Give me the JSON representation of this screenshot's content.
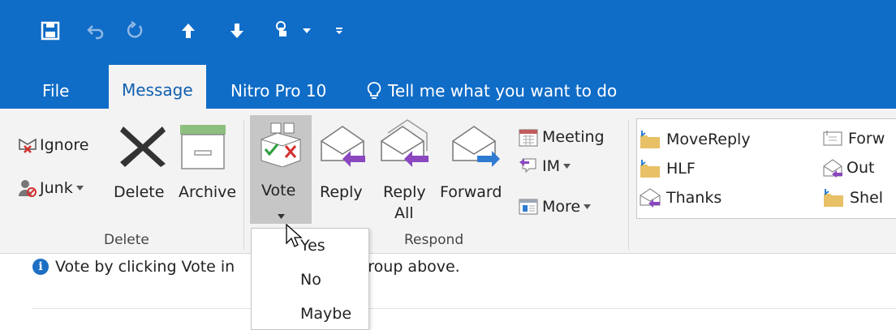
{
  "qat": {
    "icons": [
      "save-icon",
      "undo-icon",
      "redo-icon",
      "up-arrow-icon",
      "down-arrow-icon",
      "touch-mode-icon",
      "dropdown-icon",
      "customize-icon"
    ]
  },
  "tabs": [
    {
      "label": "File"
    },
    {
      "label": "Message"
    },
    {
      "label": "Nitro Pro 10"
    },
    {
      "label": "Tell me what you want to do"
    }
  ],
  "ribbon": {
    "delete_group": {
      "label": "Delete",
      "ignore": "Ignore",
      "junk": "Junk",
      "delete": "Delete",
      "archive": "Archive"
    },
    "respond_group": {
      "label": "Respond",
      "vote": "Vote",
      "reply": "Reply",
      "reply_all_line1": "Reply",
      "reply_all_line2": "All",
      "forward": "Forward",
      "meeting": "Meeting",
      "im": "IM",
      "more": "More"
    },
    "quick_steps": {
      "col1": [
        "MoveReply",
        "HLF",
        "Thanks"
      ],
      "col2": [
        "Forw",
        "Out",
        "Shel"
      ]
    }
  },
  "info_bar": {
    "text_before": "Vote by clicking Vote in",
    "text_after": "group above."
  },
  "vote_dropdown": {
    "options": [
      "Yes",
      "No",
      "Maybe"
    ]
  },
  "colors": {
    "accent": "#0f6cc7",
    "ribbon_bg": "#f3f3f3",
    "reply_arrow": "#7b3fb0",
    "forward_arrow": "#2f7bd1",
    "folder": "#e8c065"
  }
}
